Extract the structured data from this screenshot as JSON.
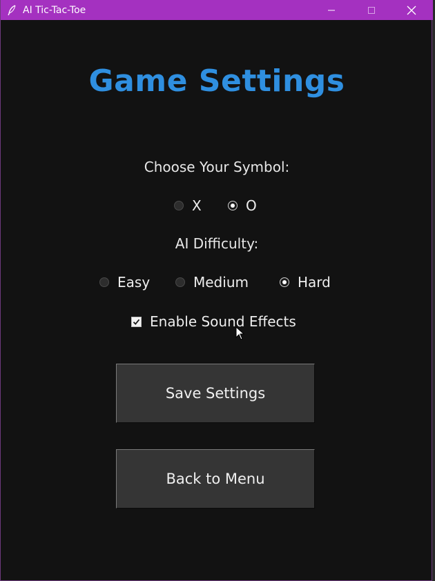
{
  "window": {
    "title": "AI Tic-Tac-Toe",
    "titlebar_color": "#a431c0",
    "app_icon": "feather-icon"
  },
  "heading": "Game Settings",
  "symbol": {
    "label": "Choose Your Symbol:",
    "options": [
      "X",
      "O"
    ],
    "selected": "O"
  },
  "difficulty": {
    "label": "AI Difficulty:",
    "options": [
      "Easy",
      "Medium",
      "Hard"
    ],
    "selected": "Hard"
  },
  "sound": {
    "label": "Enable Sound Effects",
    "checked": true
  },
  "buttons": {
    "save": "Save Settings",
    "back": "Back to Menu"
  },
  "colors": {
    "accent": "#2f8fe0",
    "background": "#121212",
    "button": "#353535"
  }
}
